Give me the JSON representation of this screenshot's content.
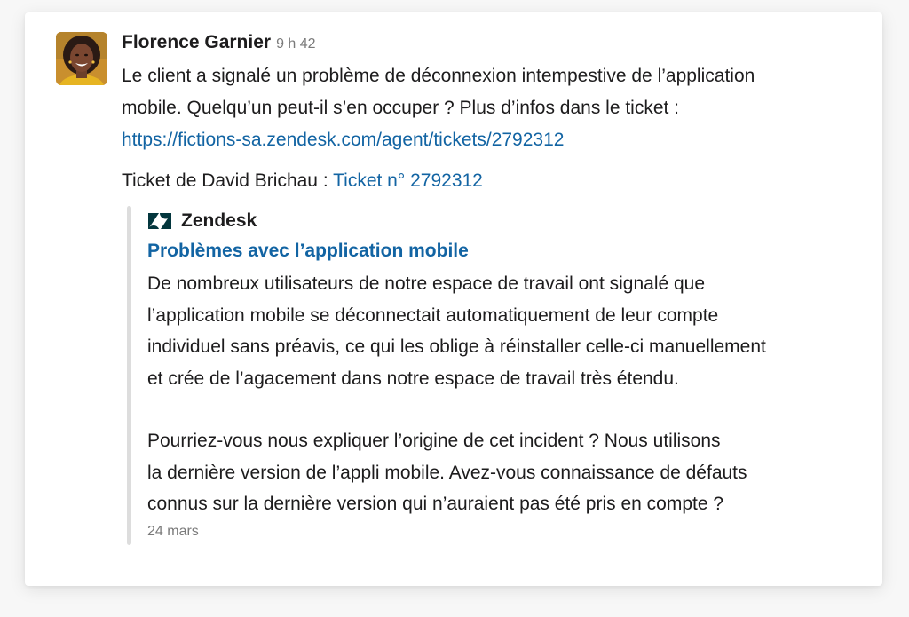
{
  "message": {
    "author": "Florence Garnier",
    "time": "9 h 42",
    "text_line1": "Le client a signalé un problème de déconnexion intempestive de l’application",
    "text_line2": "mobile. Quelqu’un peut-il s’en occuper ? Plus d’infos dans le ticket :",
    "link": "https://fictions-sa.zendesk.com/agent/tickets/2792312",
    "ticket_label": "Ticket de David Brichau :",
    "ticket_link": "Ticket n° 2792312"
  },
  "attachment": {
    "service_name": "Zendesk",
    "service_icon": "zendesk-logo-icon",
    "title": "Problèmes avec l’application mobile",
    "para1": [
      "De nombreux utilisateurs de notre espace de travail ont signalé que",
      "l’application mobile se déconnectait automatiquement de leur compte",
      "individuel sans préavis, ce qui les oblige à réinstaller celle-ci manuellement",
      "et crée de l’agacement dans notre espace de travail très étendu."
    ],
    "para2": [
      "Pourriez-vous nous expliquer l’origine de cet incident ? Nous utilisons",
      "la dernière version de l’appli mobile. Avez-vous connaissance de défauts",
      "connus sur la dernière version qui n’auraient pas été pris en compte ?"
    ],
    "date": "24 mars"
  },
  "colors": {
    "link": "#1264a3",
    "text": "#1d1c1d",
    "muted": "#7a7a7a",
    "attachment_bar": "#dddddd"
  }
}
